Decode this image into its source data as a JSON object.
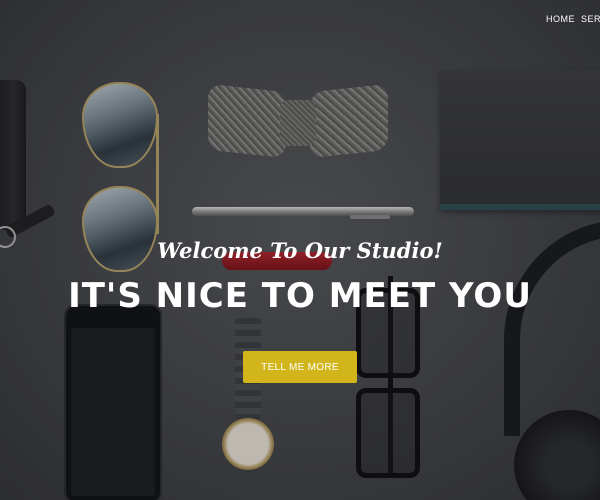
{
  "nav": {
    "items": [
      {
        "label": "HOME"
      },
      {
        "label": "SERV"
      }
    ]
  },
  "hero": {
    "subheading": "Welcome To Our Studio!",
    "heading": "IT'S NICE TO MEET YOU",
    "cta_label": "TELL ME MORE"
  },
  "colors": {
    "accent": "#d1b51a",
    "text": "#ffffff",
    "background": "#3b3c3e"
  }
}
